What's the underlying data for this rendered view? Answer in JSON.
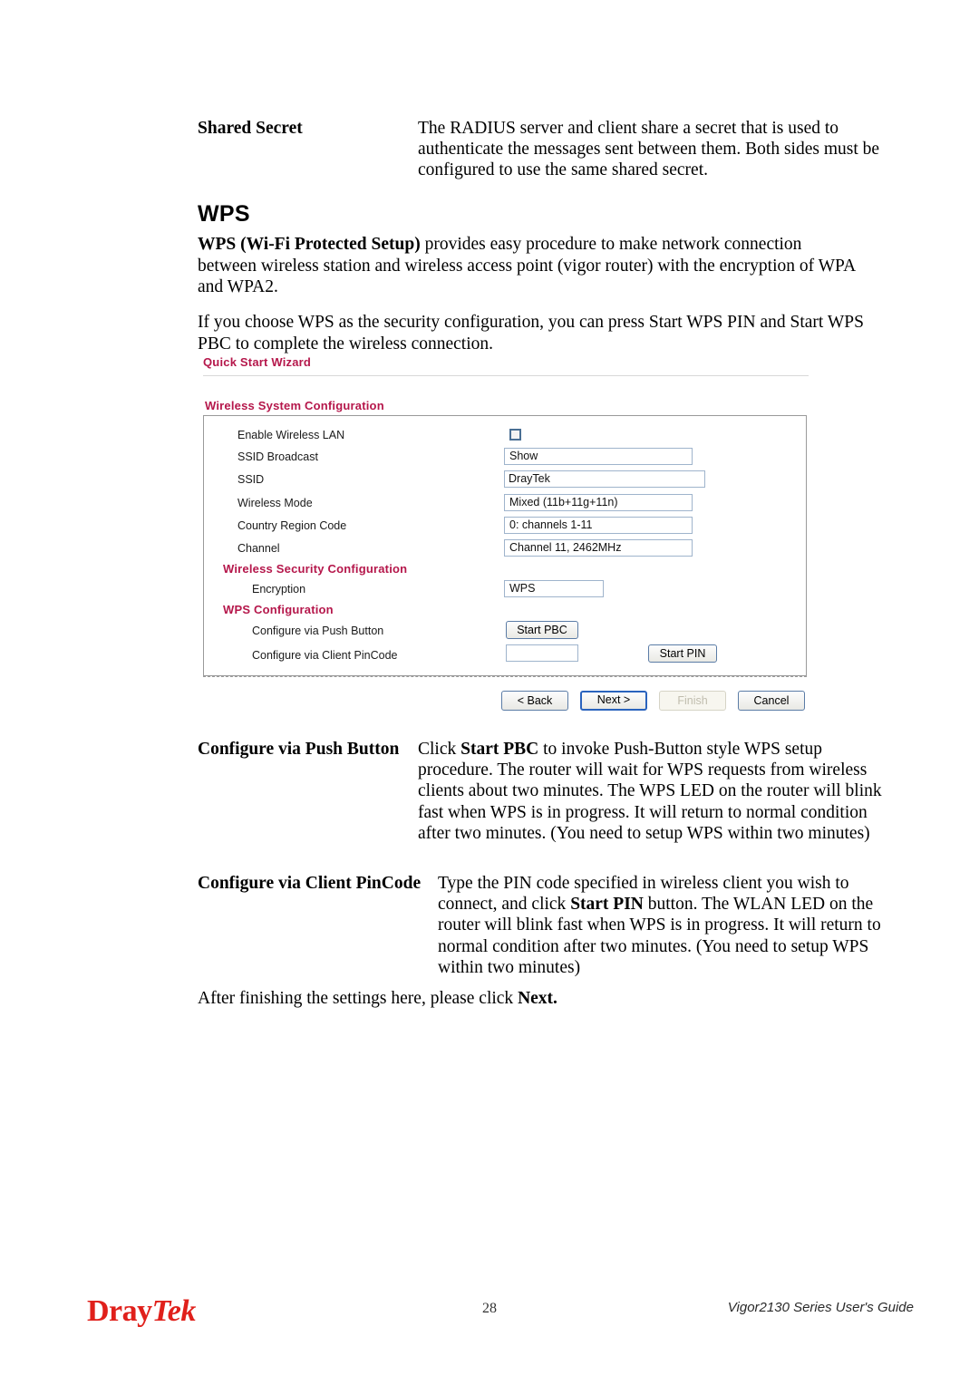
{
  "document": {
    "shared_secret": {
      "term": "Shared Secret",
      "body": "The RADIUS server and client share a secret that is used to authenticate the messages sent between them. Both sides must be configured to use the same shared secret."
    },
    "wps_heading": "WPS",
    "wps_intro_bold": "WPS (Wi-Fi Protected Setup)",
    "wps_intro_rest": " provides easy procedure to make network connection between wireless station and wireless access point (vigor router) with the encryption of WPA and WPA2.",
    "wps_note": "If you choose WPS as the security configuration, you can press Start WPS PIN and Start WPS PBC to complete the wireless connection.",
    "push_button": {
      "term": "Configure via Push Button",
      "body_1": "Click ",
      "body_bold": "Start PBC",
      "body_2": " to invoke Push-Button style WPS setup procedure. The router will wait for WPS requests from wireless clients about two minutes. The WPS LED on the router will blink fast when WPS is in progress. It will return to normal condition after two minutes. (You need to setup WPS within two minutes)"
    },
    "client_pincode": {
      "term": "Configure via Client PinCode",
      "body_1": "Type the PIN code specified in wireless client you wish to connect, and click ",
      "body_bold": "Start PIN",
      "body_2": " button. The WLAN LED on the router will blink fast when WPS is in progress. It will return to normal condition after two minutes. (You need to setup WPS within two minutes)"
    },
    "closing_1": "After finishing the settings here, please click ",
    "closing_bold": "Next."
  },
  "screenshot": {
    "wizard_title": "Quick Start Wizard",
    "sections": {
      "wireless_system": "Wireless System Configuration",
      "wireless_security": "Wireless Security Configuration",
      "wps_configuration": "WPS Configuration"
    },
    "rows": {
      "enable_wireless_lan": {
        "label": "Enable Wireless LAN",
        "checked": false
      },
      "ssid_broadcast": {
        "label": "SSID Broadcast",
        "value": "Show"
      },
      "ssid": {
        "label": "SSID",
        "value": "DrayTek"
      },
      "wireless_mode": {
        "label": "Wireless Mode",
        "value": "Mixed (11b+11g+11n)"
      },
      "country_region_code": {
        "label": "Country Region Code",
        "value": "0: channels 1-11"
      },
      "channel": {
        "label": "Channel",
        "value": "Channel 11, 2462MHz"
      },
      "encryption": {
        "label": "Encryption",
        "value": "WPS"
      },
      "push_button": {
        "label": "Configure via Push Button",
        "button": "Start PBC"
      },
      "client_pincode": {
        "label": "Configure via Client PinCode",
        "value": "",
        "button": "Start PIN"
      }
    },
    "nav_buttons": {
      "back": "< Back",
      "next": "Next >",
      "finish": "Finish",
      "cancel": "Cancel"
    },
    "colors": {
      "heading": "#b5174b",
      "select_border": "#9fb4cc",
      "arrow": "#1c4f9c"
    }
  },
  "footer": {
    "logo_dray": "Dray",
    "logo_tek": "Tek",
    "page_number": "28",
    "guide": "Vigor2130 Series User's Guide",
    "logo_color": "#e0201b"
  }
}
